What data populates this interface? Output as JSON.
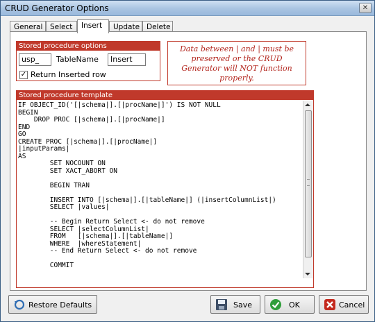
{
  "window": {
    "title": "CRUD Generator Options",
    "close": "✕"
  },
  "tabs": [
    {
      "label": "General"
    },
    {
      "label": "Select"
    },
    {
      "label": "Insert",
      "active": true
    },
    {
      "label": "Update"
    },
    {
      "label": "Delete"
    }
  ],
  "sp_options": {
    "header": "Stored procedure options",
    "prefix_value": "usp_",
    "tablename_label": "TableName",
    "tablename_value": "Insert",
    "return_row_label": "Return Inserted row",
    "return_row_checked": true
  },
  "warning": {
    "line1": "Data between | and | must be",
    "line2": "preserved or the CRUD",
    "line3": "Generator will NOT function",
    "line4": "properly."
  },
  "template": {
    "header": "Stored procedure template",
    "text": "IF OBJECT_ID('[|schema|].[|procName|]') IS NOT NULL\nBEGIN\n    DROP PROC [|schema|].[|procName|]\nEND\nGO\nCREATE PROC [|schema|].[|procName|]\n|inputParams|\nAS\n        SET NOCOUNT ON\n        SET XACT_ABORT ON\n\n        BEGIN TRAN\n\n        INSERT INTO [|schema|].[|tableName|] (|insertColumnList|)\n        SELECT |values|\n\n        -- Begin Return Select <- do not remove\n        SELECT |selectColumnList|\n        FROM   [|schema|].[|tableName|]\n        WHERE  |whereStatement|\n        -- End Return Select <- do not remove\n\n        COMMIT"
  },
  "buttons": {
    "restore": "Restore Defaults",
    "save": "Save",
    "ok": "OK",
    "cancel": "Cancel"
  },
  "colors": {
    "accent_red": "#c0392b",
    "title_blue": "#a9c4e2"
  }
}
